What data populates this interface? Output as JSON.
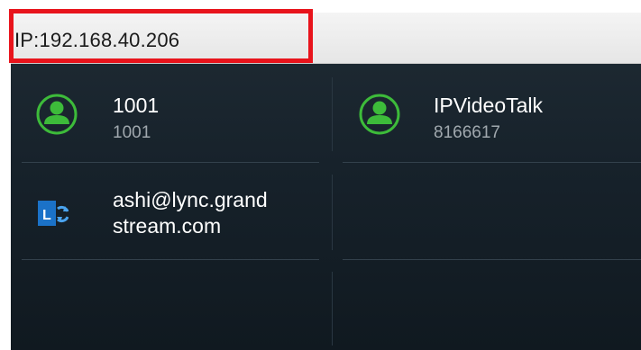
{
  "ip_bar": {
    "text": "IP:192.168.40.206"
  },
  "accounts": [
    {
      "name": "1001",
      "number": "1001",
      "icon": "contact-avatar-icon",
      "status_color": "#3dbb3a"
    },
    {
      "name": "IPVideoTalk",
      "number": "8166617",
      "icon": "contact-avatar-icon",
      "status_color": "#3dbb3a"
    },
    {
      "name": "ashi@lync.grandstream.com",
      "name_line1": "ashi@lync.grand",
      "name_line2": "stream.com",
      "icon": "lync-icon",
      "status_color": "#1b72c8"
    }
  ],
  "colors": {
    "highlight": "#e8141c",
    "avatar_green": "#3dbb3a",
    "lync_blue": "#1b72c8"
  }
}
